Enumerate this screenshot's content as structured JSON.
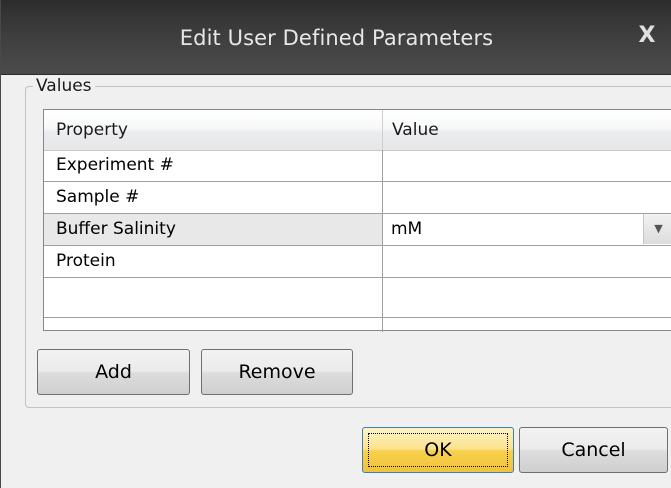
{
  "window": {
    "title": "Edit User Defined Parameters",
    "close_glyph": "X"
  },
  "group": {
    "label": "Values"
  },
  "grid": {
    "columns": [
      "Property",
      "Value"
    ],
    "rows": [
      {
        "property": "Experiment #",
        "value": ""
      },
      {
        "property": "Sample #",
        "value": ""
      },
      {
        "property": "Buffer Salinity",
        "value": "mM"
      },
      {
        "property": "Protein",
        "value": ""
      },
      {
        "property": "",
        "value": ""
      }
    ],
    "dropdown_glyph": "▼"
  },
  "buttons": {
    "add": "Add",
    "remove": "Remove",
    "ok": "OK",
    "cancel": "Cancel"
  }
}
